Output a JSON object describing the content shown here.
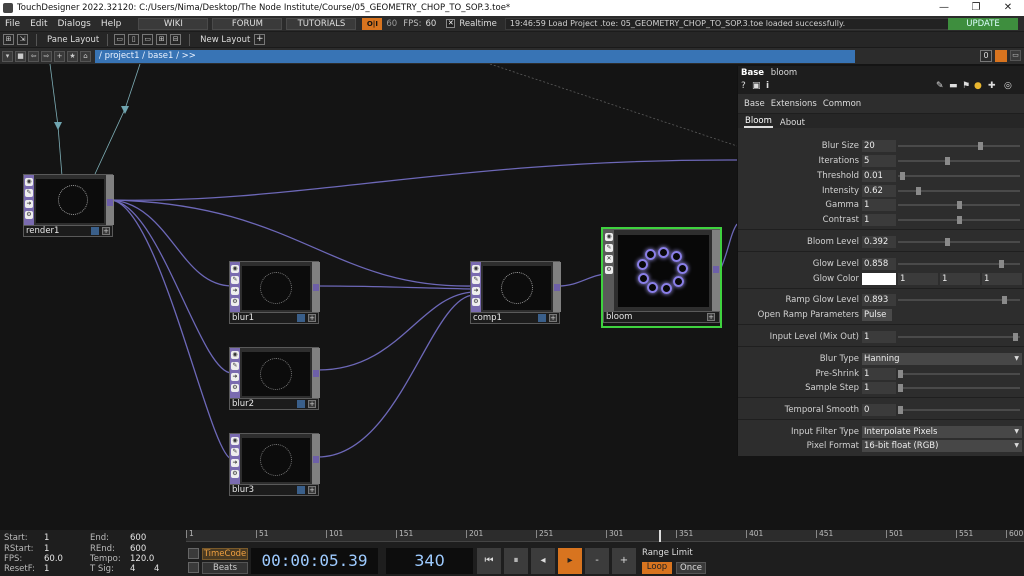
{
  "window": {
    "title": "TouchDesigner 2022.32120: C:/Users/Nima/Desktop/The Node Institute/Course/05_GEOMETRY_CHOP_TO_SOP.3.toe*",
    "min": "—",
    "max": "❐",
    "close": "✕"
  },
  "menubar": {
    "file": "File",
    "edit": "Edit",
    "dialogs": "Dialogs",
    "help": "Help",
    "wiki": "WIKI",
    "forum": "FORUM",
    "tutorials": "TUTORIALS",
    "perf": "O|I",
    "fps_small": "60",
    "fps_label": "FPS:",
    "fps_value": "60",
    "realtime_label": "Realtime",
    "realtime_check": "✕",
    "status": "19:46:59 Load Project .toe: 05_GEOMETRY_CHOP_TO_SOP.3.toe loaded successfully.",
    "update": "UPDATE"
  },
  "panebar": {
    "pane_layout": "Pane Layout",
    "new_layout": "New Layout",
    "plus": "+"
  },
  "pathbar": {
    "path": "/ project1 / base1 / >>",
    "zero": "0"
  },
  "nodes": {
    "render1": "render1",
    "blur1": "blur1",
    "blur2": "blur2",
    "blur3": "blur3",
    "comp1": "comp1",
    "bloom": "bloom"
  },
  "params": {
    "header_type": "Base",
    "header_name": "bloom",
    "tabs_top": [
      "Base",
      "Extensions",
      "Common"
    ],
    "tabs_page": [
      "Bloom",
      "About"
    ],
    "rows": {
      "blur_size": {
        "label": "Blur Size",
        "value": "20",
        "level": 0.68
      },
      "iterations": {
        "label": "Iterations",
        "value": "5",
        "level": 0.4
      },
      "threshold": {
        "label": "Threshold",
        "value": "0.01",
        "level": 0.02
      },
      "intensity": {
        "label": "Intensity",
        "value": "0.62",
        "level": 0.15
      },
      "gamma": {
        "label": "Gamma",
        "value": "1",
        "level": 0.5
      },
      "contrast": {
        "label": "Contrast",
        "value": "1",
        "level": 0.5
      },
      "bloom_level": {
        "label": "Bloom Level",
        "value": "0.392",
        "level": 0.4
      },
      "glow_level": {
        "label": "Glow Level",
        "value": "0.858",
        "level": 0.86
      },
      "glow_color": {
        "label": "Glow Color",
        "value": "#ffffff",
        "g": "1",
        "b": "1",
        "a": "1"
      },
      "ramp_glow_level": {
        "label": "Ramp Glow Level",
        "value": "0.893",
        "level": 0.89
      },
      "open_ramp": {
        "label": "Open Ramp Parameters",
        "value": "Pulse"
      },
      "input_level": {
        "label": "Input Level (Mix Out)",
        "value": "1",
        "level": 0.98
      },
      "blur_type": {
        "label": "Blur Type",
        "value": "Hanning"
      },
      "pre_shrink": {
        "label": "Pre-Shrink",
        "value": "1",
        "level": 0.0
      },
      "sample_step": {
        "label": "Sample Step",
        "value": "1",
        "level": 0.0
      },
      "temporal_smooth": {
        "label": "Temporal Smooth",
        "value": "0",
        "level": 0.0
      },
      "input_filter_type": {
        "label": "Input Filter Type",
        "value": "Interpolate Pixels"
      },
      "pixel_format": {
        "label": "Pixel Format",
        "value": "16-bit float (RGB)"
      }
    }
  },
  "timeline": {
    "start_label": "Start:",
    "start": "1",
    "end_label": "End:",
    "end": "600",
    "rstart_label": "RStart:",
    "rstart": "1",
    "rend_label": "REnd:",
    "rend": "600",
    "fps_label": "FPS:",
    "fps": "60.0",
    "tempo_label": "Tempo:",
    "tempo": "120.0",
    "resetf_label": "ResetF:",
    "resetf": "1",
    "tsig_label": "T Sig:",
    "tsig_a": "4",
    "tsig_b": "4",
    "ticks": [
      "1",
      "51",
      "101",
      "151",
      "201",
      "251",
      "301",
      "351",
      "401",
      "451",
      "501",
      "551",
      "600"
    ],
    "timecode_btn": "TimeCode",
    "beats_btn": "Beats",
    "timecode": "00:00:05.39",
    "frame": "340",
    "range_limit": "Range Limit",
    "loop": "Loop",
    "once": "Once",
    "ctl_rewind": "⏮",
    "ctl_pause": "⏸",
    "ctl_back": "◂",
    "ctl_play": "▸",
    "ctl_minus": "-",
    "ctl_plus": "+"
  }
}
